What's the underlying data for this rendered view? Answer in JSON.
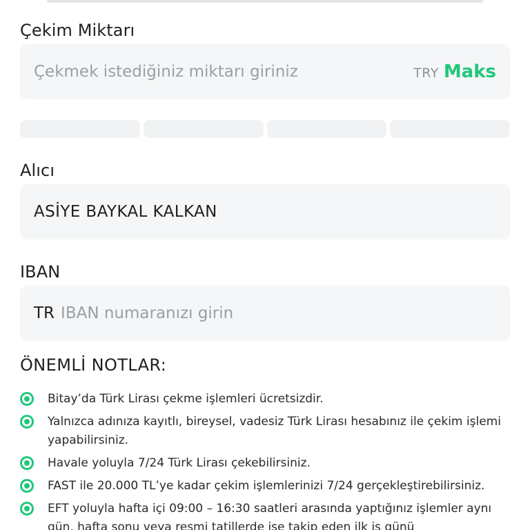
{
  "amount": {
    "label": "Çekim Miktarı",
    "placeholder": "Çekmek istediğiniz miktarı giriniz",
    "currency": "TRY",
    "max_label": "Maks",
    "quick_amounts": [
      "",
      "",
      "",
      ""
    ]
  },
  "recipient": {
    "label": "Alıcı",
    "value": "ASİYE BAYKAL KALKAN"
  },
  "iban": {
    "label": "IBAN",
    "prefix": "TR",
    "placeholder": "IBAN numaranızı girin"
  },
  "notes": {
    "title": "ÖNEMLİ NOTLAR:",
    "items": [
      "Bitay’da Türk Lirası çekme işlemleri ücretsizdir.",
      "Yalnızca adınıza kayıtlı, bireysel, vadesiz Türk Lirası hesabınız ile çekim işlemi yapabilirsiniz.",
      "Havale yoluyla 7/24 Türk Lirası çekebilirsiniz.",
      "FAST ile 20.000 TL’ye kadar çekim işlemlerinizi 7/24 gerçekleştirebilirsiniz.",
      "EFT yoluyla hafta içi 09:00 – 16:30 saatleri arasında yaptığınız işlemler aynı gün, hafta sonu veya resmi tatillerde ise takip eden ilk iş günü"
    ]
  },
  "colors": {
    "accent": "#21c77a",
    "field_background": "#f5f6f7",
    "placeholder_text": "#9b9ea3"
  },
  "icons": {
    "note_bullet": "radio-dot-icon"
  }
}
